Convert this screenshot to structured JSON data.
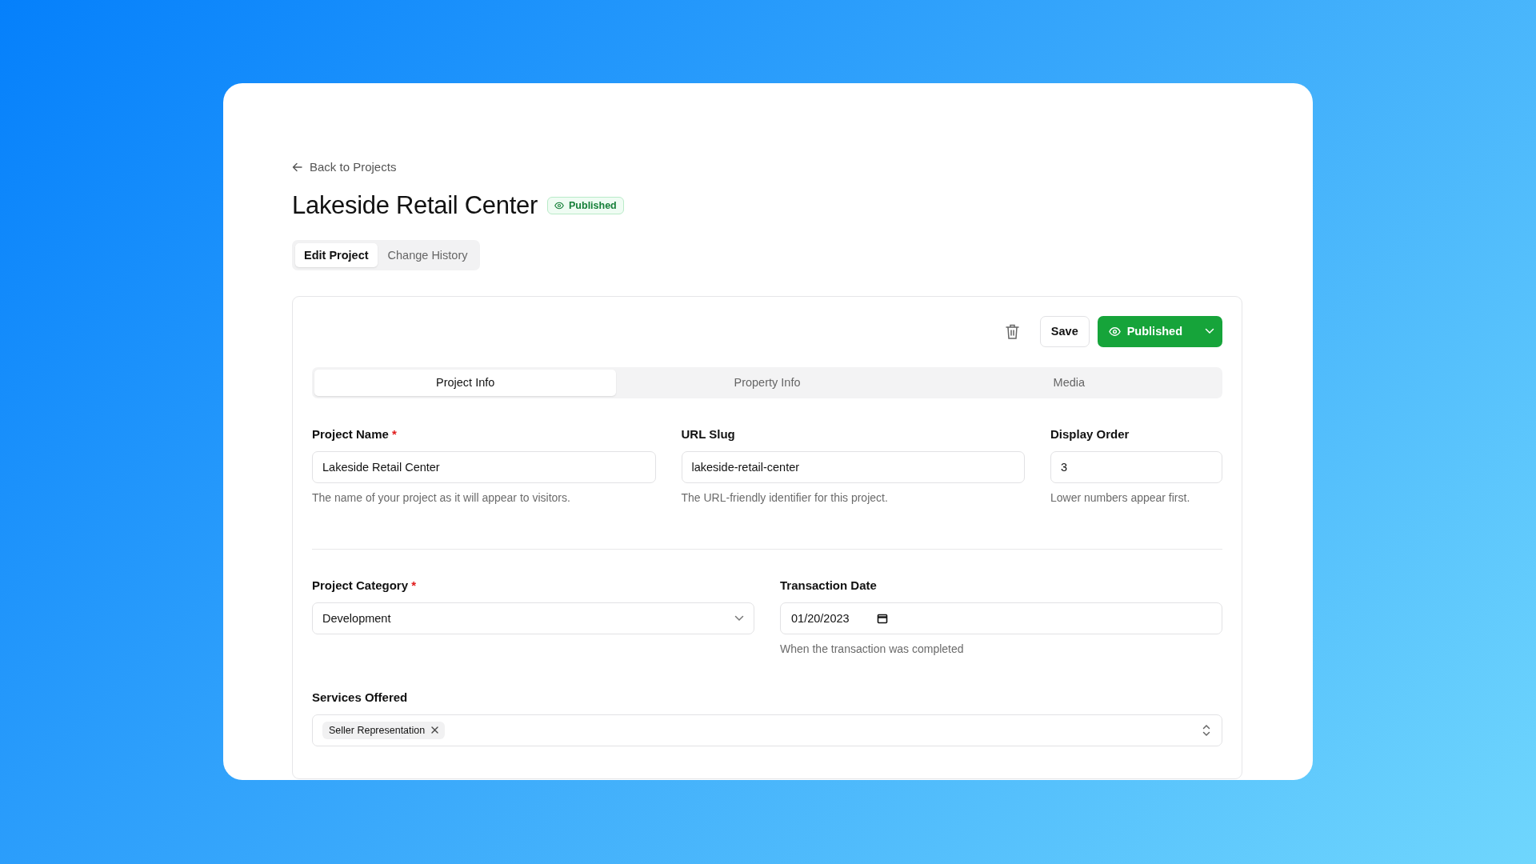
{
  "back_link": {
    "label": "Back to Projects"
  },
  "title": "Lakeside Retail Center",
  "status_badge": {
    "label": "Published"
  },
  "page_tabs": [
    {
      "label": "Edit Project",
      "selected": true
    },
    {
      "label": "Change History",
      "selected": false
    }
  ],
  "toolbar": {
    "save_label": "Save",
    "publish_label": "Published"
  },
  "section_tabs": [
    {
      "label": "Project Info",
      "selected": true
    },
    {
      "label": "Property Info",
      "selected": false
    },
    {
      "label": "Media",
      "selected": false
    }
  ],
  "required_marker": "*",
  "field_rows": [
    {
      "divider_after": true,
      "fields": [
        {
          "kind": "text",
          "label": "Project Name",
          "required": true,
          "value": "Lakeside Retail Center",
          "hint": "The name of your project as it will appear to visitors."
        },
        {
          "kind": "text",
          "label": "URL Slug",
          "required": false,
          "value": "lakeside-retail-center",
          "hint": "The URL-friendly identifier for this project."
        },
        {
          "kind": "text",
          "label": "Display Order",
          "required": false,
          "value": "3",
          "hint": "Lower numbers appear first."
        }
      ]
    },
    {
      "divider_after": false,
      "fields": [
        {
          "kind": "select",
          "label": "Project Category",
          "required": true,
          "value": "Development"
        },
        {
          "kind": "date",
          "label": "Transaction Date",
          "required": false,
          "value": "01/20/2023",
          "hint": "When the transaction was completed"
        }
      ]
    },
    {
      "divider_after": false,
      "fields": [
        {
          "kind": "multiselect",
          "label": "Services Offered",
          "required": false,
          "tags": [
            {
              "label": "Seller Representation"
            }
          ]
        }
      ]
    }
  ]
}
